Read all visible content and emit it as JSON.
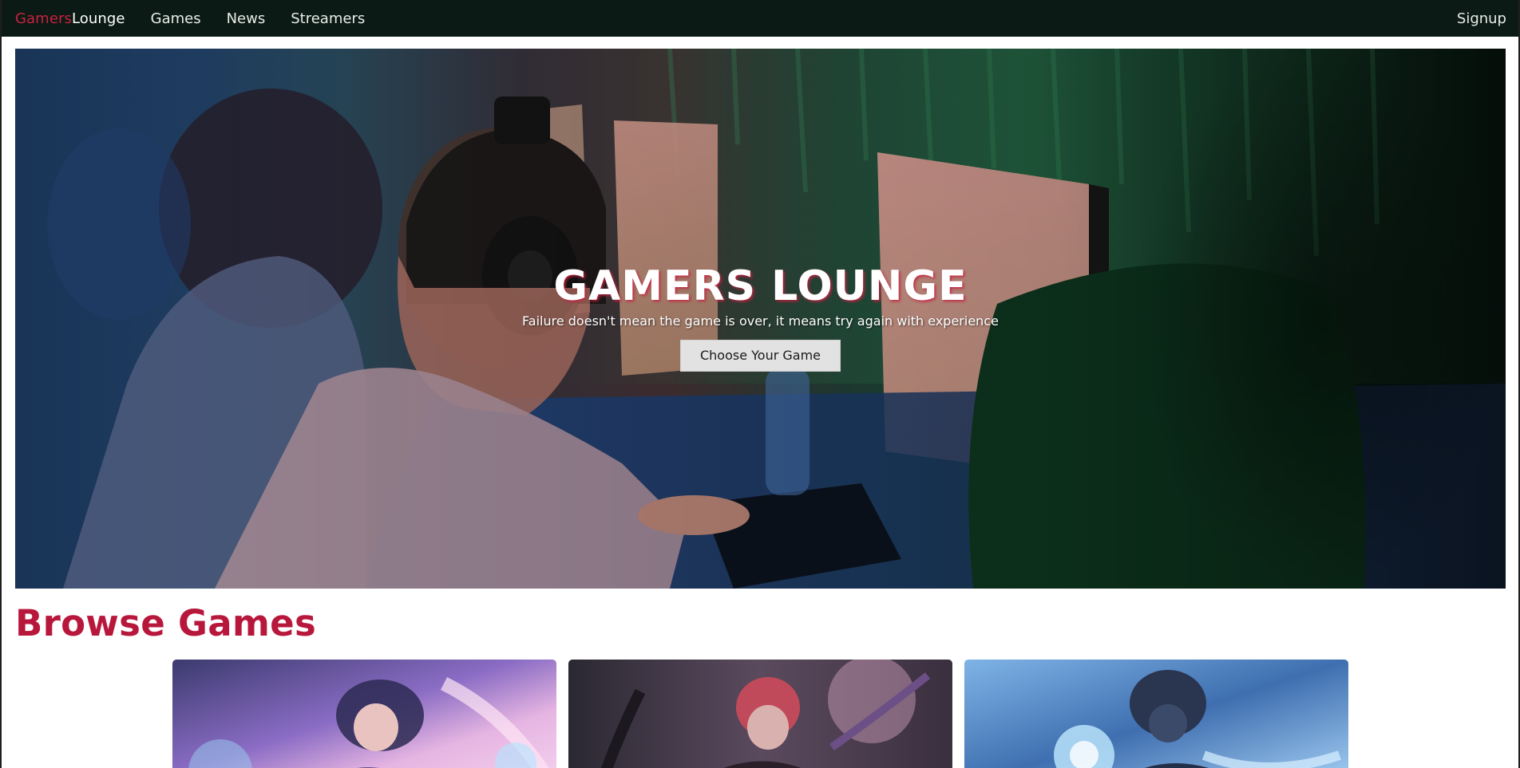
{
  "navbar": {
    "brand_part1": "Gamers",
    "brand_part2": "Lounge",
    "links": [
      "Games",
      "News",
      "Streamers"
    ],
    "signup": "Signup",
    "brand_color": "#c8203f",
    "bg_color": "#0b1a14"
  },
  "hero": {
    "title": "GAMERS LOUNGE",
    "tagline": "Failure doesn't mean the game is over, it means try again with experience",
    "cta": "Choose Your Game"
  },
  "browse": {
    "title": "Browse Games",
    "accent_color": "#b8173c"
  }
}
